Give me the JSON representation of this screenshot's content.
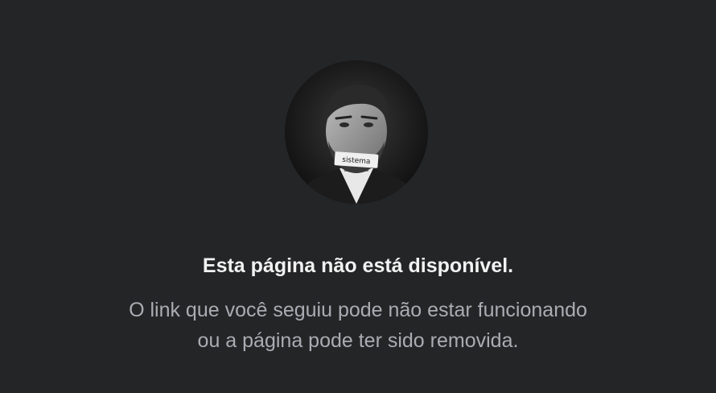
{
  "profile": {
    "avatar_caption": "sistema"
  },
  "error": {
    "title": "Esta página não está disponível.",
    "description_line1": "O link que você seguiu pode não estar funcionando",
    "description_line2": "ou a página pode ter sido removida."
  },
  "colors": {
    "background": "#242526",
    "title": "#f2f2f2",
    "description": "#a9adb3"
  }
}
